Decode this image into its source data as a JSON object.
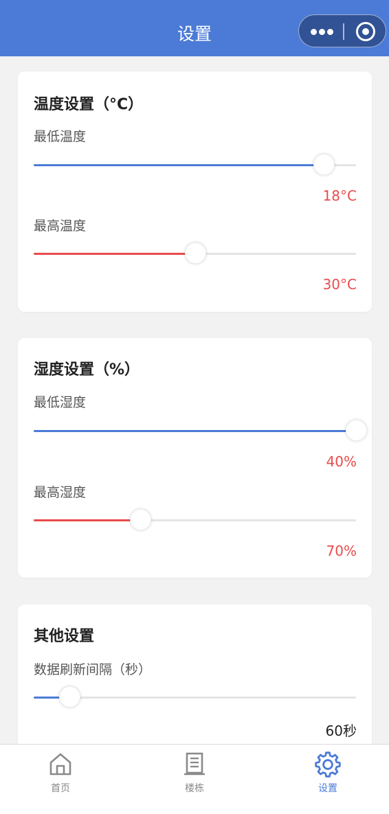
{
  "navbar": {
    "title": "设置"
  },
  "temperature": {
    "title": "温度设置（°C）",
    "min_label": "最低温度",
    "min_value": "18°C",
    "min_slider_level": 0.9,
    "max_label": "最高温度",
    "max_value": "30°C",
    "max_slider_level": 0.5
  },
  "humidity": {
    "title": "湿度设置（%）",
    "min_label": "最低湿度",
    "min_value": "40%",
    "min_slider_level": 1.0,
    "max_label": "最高湿度",
    "max_value": "70%",
    "max_slider_level": 0.33
  },
  "other": {
    "title": "其他设置",
    "refresh_label": "数据刷新间隔（秒）",
    "refresh_value": "60秒",
    "refresh_slider_level": 0.11
  },
  "tabbar": {
    "items": [
      {
        "label": "首页",
        "icon": "home-icon",
        "active": false
      },
      {
        "label": "楼栋",
        "icon": "building-icon",
        "active": false
      },
      {
        "label": "设置",
        "icon": "gear-icon",
        "active": true
      }
    ]
  },
  "colors": {
    "primary": "#4b7bd6",
    "danger": "#e94b4b",
    "track": "#e4e4e4",
    "background": "#f2f2f2"
  }
}
